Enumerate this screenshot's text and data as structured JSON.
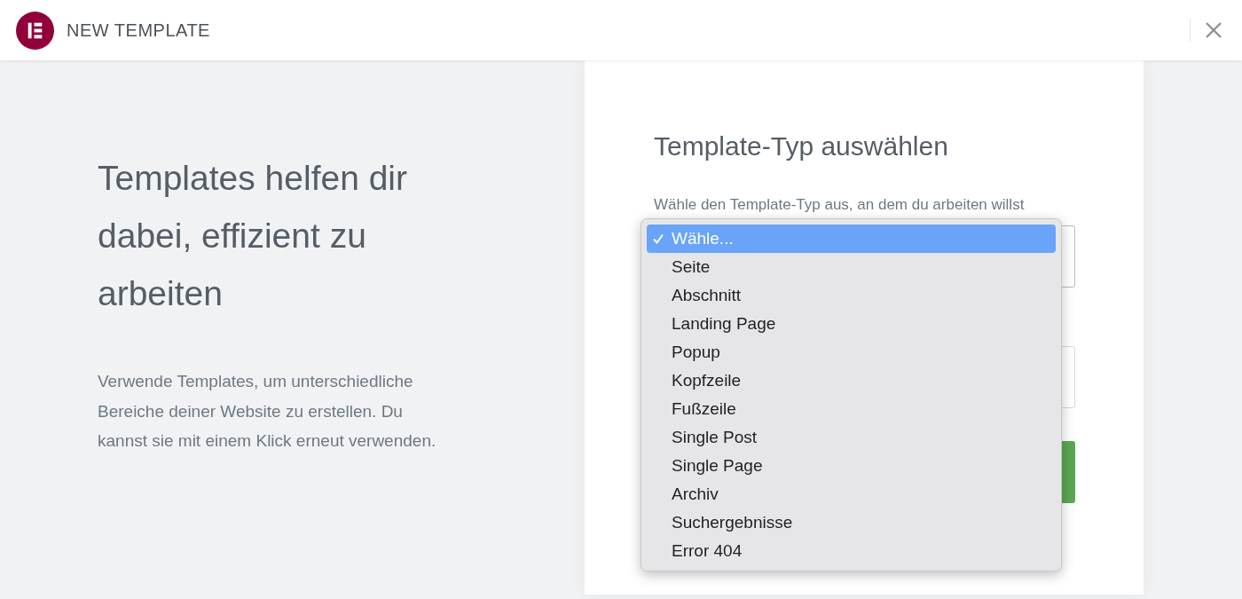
{
  "header": {
    "title": "NEW TEMPLATE"
  },
  "intro": {
    "heading": "Templates helfen dir dabei, effizient zu arbeiten",
    "text": "Verwende Templates, um unterschiedliche Bereiche deiner Website zu erstellen. Du kannst sie mit einem Klick erneut verwenden."
  },
  "form": {
    "title": "Template-Typ auswählen",
    "description": "Wähle den Template-Typ aus, an dem du arbeiten willst",
    "dropdown": {
      "options": [
        {
          "label": "Wähle...",
          "selected": true
        },
        {
          "label": "Seite",
          "selected": false
        },
        {
          "label": "Abschnitt",
          "selected": false
        },
        {
          "label": "Landing Page",
          "selected": false
        },
        {
          "label": "Popup",
          "selected": false
        },
        {
          "label": "Kopfzeile",
          "selected": false
        },
        {
          "label": "Fußzeile",
          "selected": false
        },
        {
          "label": "Single Post",
          "selected": false
        },
        {
          "label": "Single Page",
          "selected": false
        },
        {
          "label": "Archiv",
          "selected": false
        },
        {
          "label": "Suchergebnisse",
          "selected": false
        },
        {
          "label": "Error 404",
          "selected": false
        }
      ]
    }
  }
}
